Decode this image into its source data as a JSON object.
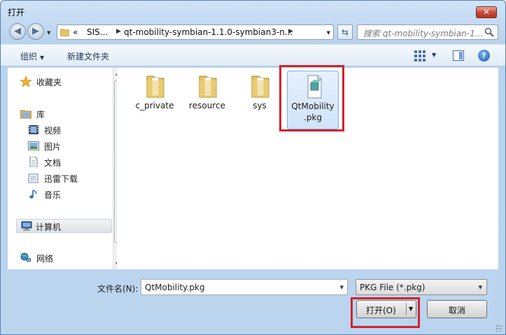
{
  "window": {
    "title": "打开",
    "close_glyph": "✕"
  },
  "navigation": {
    "back_icon": "back-arrow-icon",
    "forward_icon": "forward-arrow-icon",
    "breadcrumb_overflow": "«",
    "breadcrumb": [
      "SIS...",
      "qt-mobility-symbian-1.1.0-symbian3-n..."
    ],
    "search_placeholder": "搜索 qt-mobility-symbian-1..."
  },
  "toolbar": {
    "organize": "组织",
    "new_folder": "新建文件夹",
    "help": "?"
  },
  "sidebar": {
    "items": [
      {
        "label": "收藏夹",
        "icon": "star-icon"
      },
      {
        "label": "库",
        "icon": "library-icon"
      },
      {
        "label": "视频",
        "icon": "video-icon"
      },
      {
        "label": "图片",
        "icon": "picture-icon"
      },
      {
        "label": "文档",
        "icon": "document-icon"
      },
      {
        "label": "迅雷下载",
        "icon": "download-icon"
      },
      {
        "label": "音乐",
        "icon": "music-icon"
      },
      {
        "label": "计算机",
        "icon": "computer-icon"
      },
      {
        "label": "网络",
        "icon": "network-icon"
      }
    ]
  },
  "files": [
    {
      "name": "c_private",
      "type": "folder"
    },
    {
      "name": "resource",
      "type": "folder"
    },
    {
      "name": "sys",
      "type": "folder"
    },
    {
      "name": "QtMobility\n.pkg",
      "line1": "QtMobility",
      "line2": ".pkg",
      "type": "file",
      "selected": true
    }
  ],
  "bottom": {
    "filename_label": "文件名(N):",
    "filename_value": "QtMobility.pkg",
    "filetype_value": "PKG File (*.pkg)",
    "open_button": "打开(O)",
    "cancel_button": "取消"
  },
  "colors": {
    "highlight": "#d2232a",
    "selection": "#cfe3f9"
  }
}
